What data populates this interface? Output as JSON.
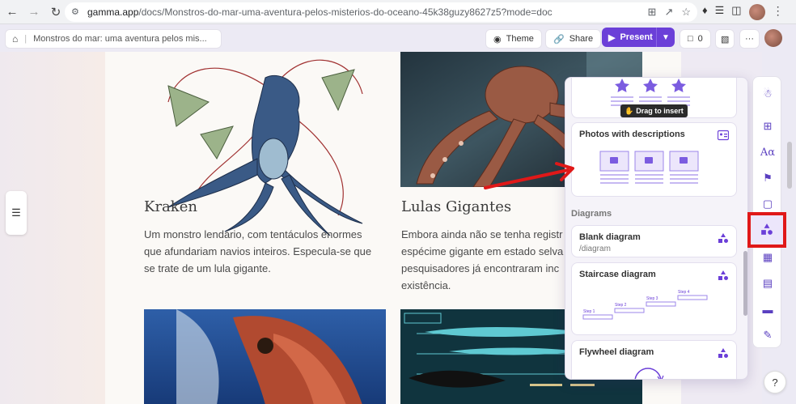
{
  "browser": {
    "url_host": "gamma.app",
    "url_path": "/docs/Monstros-do-mar-uma-aventura-pelos-misterios-do-oceano-45k38guzy8627z5?mode=doc"
  },
  "topbar": {
    "breadcrumb": "Monstros do mar: uma aventura pelos mis...",
    "theme_label": "Theme",
    "share_label": "Share",
    "present_label": "Present",
    "comments_count": "0"
  },
  "cards": [
    {
      "title": "Kraken",
      "lines": [
        "Um monstro lendário, com tentáculos enormes",
        "que afundariam navios inteiros. Especula-se que",
        "se trate de um lula gigante."
      ]
    },
    {
      "title": "Lulas Gigantes",
      "lines": [
        "Embora ainda não se tenha registr",
        "espécime gigante em estado selva",
        "pesquisadores já encontraram inc",
        "existência."
      ]
    }
  ],
  "panel": {
    "tooltip": "Drag to insert",
    "photos_title": "Photos with descriptions",
    "diagrams_label": "Diagrams",
    "blank_title": "Blank diagram",
    "blank_sub": "/diagram",
    "staircase_title": "Staircase diagram",
    "steps": [
      "Step 1",
      "Step 2",
      "Step 3",
      "Step 4"
    ],
    "flywheel_title": "Flywheel diagram"
  },
  "help_label": "?",
  "colors": {
    "accent": "#6b3fd8",
    "highlight": "#e01818",
    "arrow": "#e01818"
  }
}
